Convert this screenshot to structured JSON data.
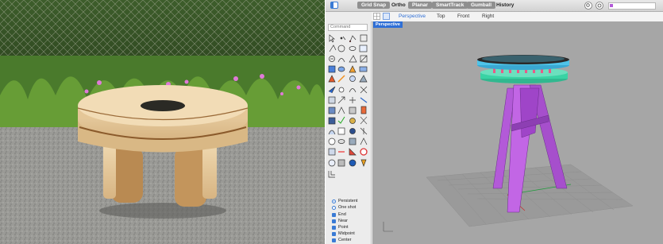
{
  "toolbar": {
    "toggles": [
      "Grid Snap",
      "Ortho",
      "Planar",
      "SmartTrack",
      "Gumball",
      "History"
    ]
  },
  "tabs": [
    "Perspective",
    "Top",
    "Front",
    "Right"
  ],
  "viewport": {
    "label": "Perspective"
  },
  "command": {
    "placeholder": "Command"
  },
  "osnap": {
    "mode_persistent": "Persistent",
    "mode_oneshot": "One shot",
    "items": [
      "End",
      "Near",
      "Point",
      "Midpoint",
      "Center"
    ]
  },
  "colors": {
    "accent": "#2f6fd6",
    "leg": "#b35ad8",
    "disc_top": "#4fc3e8",
    "disc_bottom": "#39d3a4",
    "pegs": "#e85a8a"
  },
  "icons": [
    "sidebar-icon",
    "grid-icon",
    "viewport-layout-icon",
    "search-icon",
    "settings-icon",
    "command-line-icon"
  ]
}
